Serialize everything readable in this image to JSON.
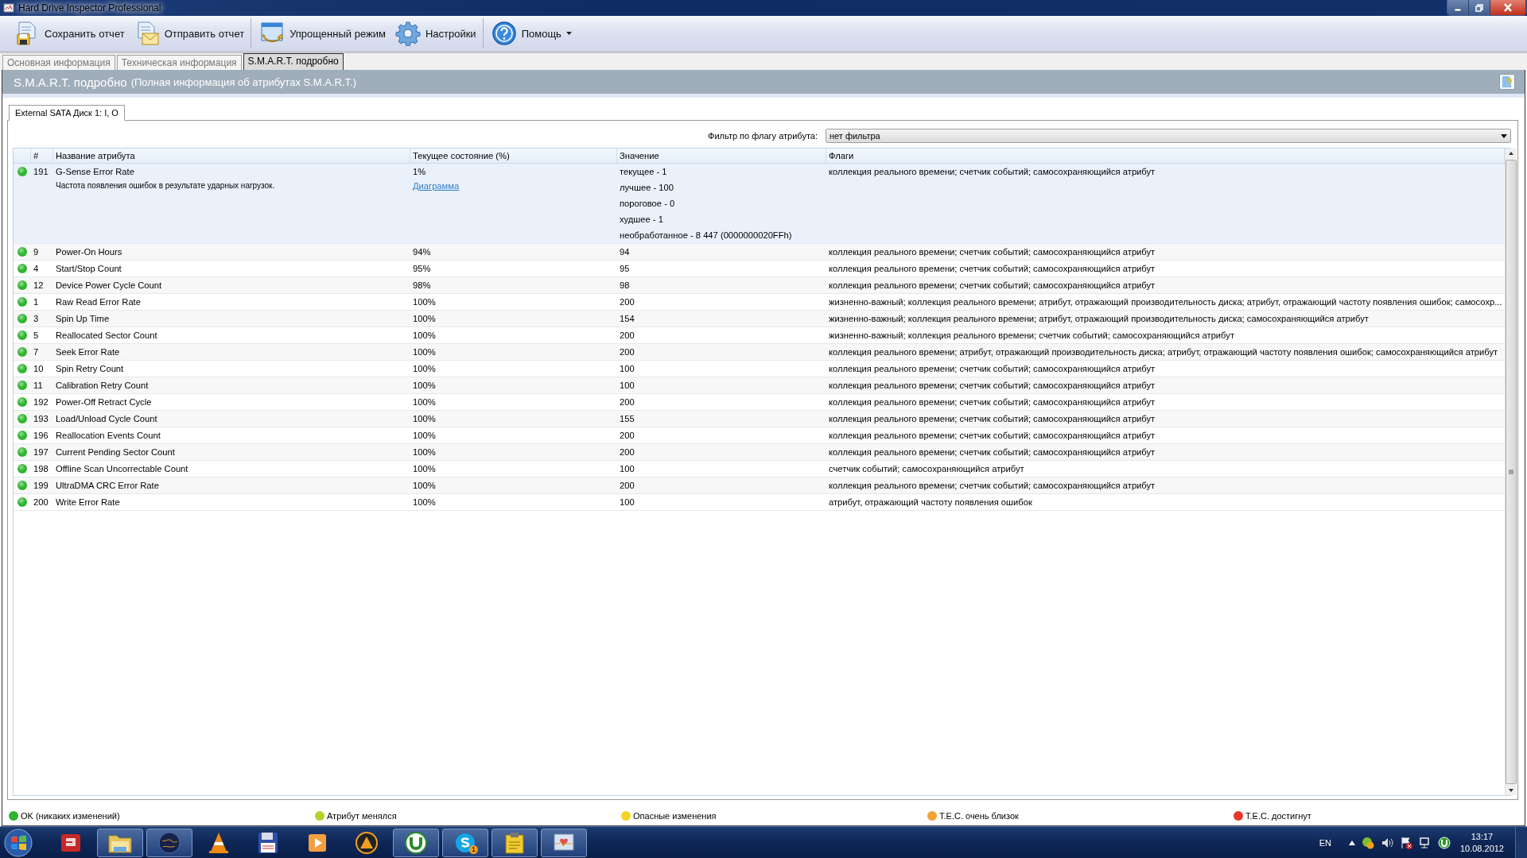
{
  "window": {
    "title": "Hard Drive Inspector Professional"
  },
  "toolbar": [
    {
      "kind": "save",
      "label": "Сохранить отчет",
      "separator_after": false,
      "dropdown": false
    },
    {
      "kind": "send",
      "label": "Отправить отчет",
      "separator_after": true,
      "dropdown": false
    },
    {
      "kind": "simple",
      "label": "Упрощенный режим",
      "separator_after": false,
      "dropdown": false
    },
    {
      "kind": "settings",
      "label": "Настройки",
      "separator_after": true,
      "dropdown": false
    },
    {
      "kind": "help",
      "label": "Помощь",
      "separator_after": false,
      "dropdown": true
    }
  ],
  "tabs": [
    {
      "label": "Основная информация",
      "selected": false
    },
    {
      "label": "Техническая информация",
      "selected": false
    },
    {
      "label": "S.M.A.R.T. подробно",
      "selected": true
    }
  ],
  "section": {
    "title": "S.M.A.R.T. подробно",
    "subtitle": "(Полная информация об атрибутах S.M.A.R.T.)"
  },
  "drive_tab": {
    "label": "External SATA Диск 1: I, O"
  },
  "filter": {
    "label": "Фильтр по флагу атрибута:",
    "value": "нет фильтра"
  },
  "table": {
    "columns": [
      "#",
      "Название атрибута",
      "Текущее состояние (%)",
      "Значение",
      "Флаги"
    ],
    "rows": [
      {
        "color": "#2fb52f",
        "id": "191",
        "name": "G-Sense Error Rate",
        "state": "1%",
        "value": "текущее - 1",
        "flags": "коллекция реального времени; счетчик событий; самосохраняющийся атрибут",
        "expanded": true,
        "description": "Частота появления ошибок в результате ударных нагрузок.",
        "link": "Диаграмма",
        "value_details": [
          "лучшее - 100",
          "пороговое - 0",
          "худшее - 1",
          "необработанное - 8 447 (0000000020FFh)"
        ]
      },
      {
        "color": "#2fb52f",
        "id": "9",
        "name": "Power-On Hours",
        "state": "94%",
        "value": "94",
        "flags": "коллекция реального времени; счетчик событий; самосохраняющийся атрибут",
        "expanded": false
      },
      {
        "color": "#2fb52f",
        "id": "4",
        "name": "Start/Stop Count",
        "state": "95%",
        "value": "95",
        "flags": "коллекция реального времени; счетчик событий; самосохраняющийся атрибут",
        "expanded": false
      },
      {
        "color": "#2fb52f",
        "id": "12",
        "name": "Device Power Cycle Count",
        "state": "98%",
        "value": "98",
        "flags": "коллекция реального времени; счетчик событий; самосохраняющийся атрибут",
        "expanded": false
      },
      {
        "color": "#2fb52f",
        "id": "1",
        "name": "Raw Read Error Rate",
        "state": "100%",
        "value": "200",
        "flags": "жизненно-важный; коллекция реального времени; атрибут, отражающий производительность диска; атрибут, отражающий частоту появления ошибок; самосохр...",
        "expanded": false
      },
      {
        "color": "#2fb52f",
        "id": "3",
        "name": "Spin Up Time",
        "state": "100%",
        "value": "154",
        "flags": "жизненно-важный; коллекция реального времени; атрибут, отражающий производительность диска; самосохраняющийся атрибут",
        "expanded": false
      },
      {
        "color": "#2fb52f",
        "id": "5",
        "name": "Reallocated Sector Count",
        "state": "100%",
        "value": "200",
        "flags": "жизненно-важный; коллекция реального времени; счетчик событий; самосохраняющийся атрибут",
        "expanded": false
      },
      {
        "color": "#2fb52f",
        "id": "7",
        "name": "Seek Error Rate",
        "state": "100%",
        "value": "200",
        "flags": "коллекция реального времени; атрибут, отражающий производительность диска; атрибут, отражающий частоту появления ошибок; самосохраняющийся атрибут",
        "expanded": false
      },
      {
        "color": "#2fb52f",
        "id": "10",
        "name": "Spin Retry Count",
        "state": "100%",
        "value": "100",
        "flags": "коллекция реального времени; счетчик событий; самосохраняющийся атрибут",
        "expanded": false
      },
      {
        "color": "#2fb52f",
        "id": "11",
        "name": "Calibration Retry Count",
        "state": "100%",
        "value": "100",
        "flags": "коллекция реального времени; счетчик событий; самосохраняющийся атрибут",
        "expanded": false
      },
      {
        "color": "#2fb52f",
        "id": "192",
        "name": "Power-Off Retract Cycle",
        "state": "100%",
        "value": "200",
        "flags": "коллекция реального времени; счетчик событий; самосохраняющийся атрибут",
        "expanded": false
      },
      {
        "color": "#2fb52f",
        "id": "193",
        "name": "Load/Unload Cycle Count",
        "state": "100%",
        "value": "155",
        "flags": "коллекция реального времени; счетчик событий; самосохраняющийся атрибут",
        "expanded": false
      },
      {
        "color": "#2fb52f",
        "id": "196",
        "name": "Reallocation Events Count",
        "state": "100%",
        "value": "200",
        "flags": "коллекция реального времени; счетчик событий; самосохраняющийся атрибут",
        "expanded": false
      },
      {
        "color": "#2fb52f",
        "id": "197",
        "name": "Current Pending Sector Count",
        "state": "100%",
        "value": "200",
        "flags": "коллекция реального времени; счетчик событий; самосохраняющийся атрибут",
        "expanded": false
      },
      {
        "color": "#2fb52f",
        "id": "198",
        "name": "Offline Scan Uncorrectable Count",
        "state": "100%",
        "value": "100",
        "flags": "счетчик событий; самосохраняющийся атрибут",
        "expanded": false
      },
      {
        "color": "#2fb52f",
        "id": "199",
        "name": "UltraDMA CRC Error Rate",
        "state": "100%",
        "value": "200",
        "flags": "коллекция реального времени; счетчик событий; самосохраняющийся атрибут",
        "expanded": false
      },
      {
        "color": "#2fb52f",
        "id": "200",
        "name": "Write Error Rate",
        "state": "100%",
        "value": "100",
        "flags": "атрибут, отражающий частоту появления ошибок",
        "expanded": false
      }
    ]
  },
  "legend": [
    {
      "color": "#2fb52f",
      "label": "OK (никаких изменений)"
    },
    {
      "color": "#b5d22a",
      "label": "Атрибут менялся"
    },
    {
      "color": "#f5d224",
      "label": "Опасные изменения"
    },
    {
      "color": "#f5a032",
      "label": "T.E.C. очень близок"
    },
    {
      "color": "#e8382c",
      "label": "T.E.C. достигнут"
    }
  ],
  "taskbar": {
    "apps": [
      {
        "kind": "game",
        "running": false
      },
      {
        "kind": "folder",
        "running": true
      },
      {
        "kind": "globe",
        "running": true
      },
      {
        "kind": "cone",
        "running": false
      },
      {
        "kind": "floppy",
        "running": false
      },
      {
        "kind": "player",
        "running": false
      },
      {
        "kind": "triangle",
        "running": false
      },
      {
        "kind": "torrent",
        "running": true
      },
      {
        "kind": "skype",
        "running": true,
        "badge": "1"
      },
      {
        "kind": "clipboard",
        "running": true
      },
      {
        "kind": "monitor",
        "running": true
      }
    ],
    "language": "EN",
    "time": "13:17",
    "date": "10.08.2012"
  }
}
